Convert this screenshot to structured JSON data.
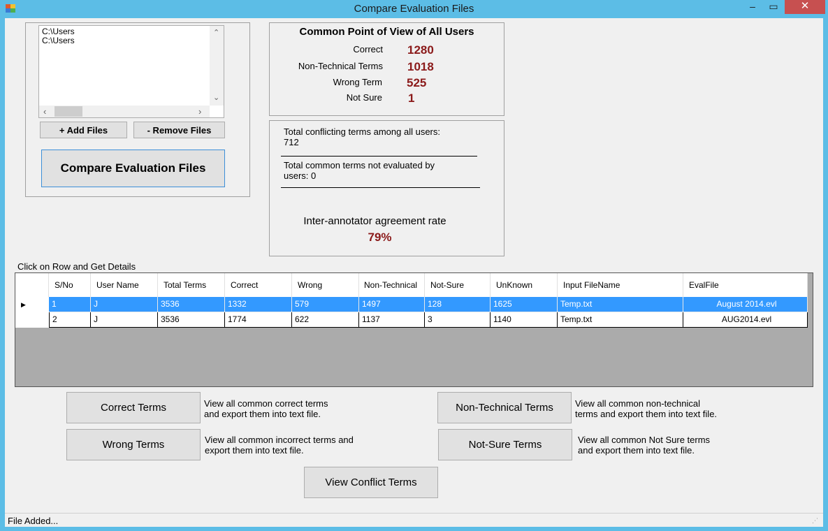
{
  "window": {
    "title": "Compare Evaluation Files",
    "min": "–",
    "max": "▭",
    "close": "✕"
  },
  "files": {
    "items": [
      "C:\\Users",
      "C:\\Users"
    ],
    "add_label": "+ Add Files",
    "remove_label": "- Remove Files",
    "compare_label": "Compare Evaluation Files"
  },
  "common": {
    "title": "Common Point of View of All Users",
    "stats": [
      {
        "label": "Correct",
        "value": "1280"
      },
      {
        "label": "Non-Technical Terms",
        "value": "1018"
      },
      {
        "label": "Wrong Term",
        "value": "525"
      },
      {
        "label": "Not Sure",
        "value": "1"
      }
    ]
  },
  "summary": {
    "conflicting_label": "Total conflicting terms among all users:",
    "conflicting_value": "712",
    "not_evaluated_line1": "Total common terms not evaluated by",
    "not_evaluated_line2": "users: 0",
    "agreement_label": "Inter-annotator agreement rate",
    "agreement_value": "79%"
  },
  "grid": {
    "hint": "Click on Row and Get Details",
    "columns": [
      "S/No",
      "User Name",
      "Total Terms",
      "Correct",
      "Wrong",
      "Non-Technical",
      "Not-Sure",
      "UnKnown",
      "Input FileName",
      "EvalFile"
    ],
    "rows": [
      [
        "1",
        "J",
        "3536",
        "1332",
        "579",
        "1497",
        "128",
        "1625",
        "Temp.txt",
        "August 2014.evl"
      ],
      [
        "2",
        "J",
        "3536",
        "1774",
        "622",
        "1137",
        "3",
        "1140",
        "Temp.txt",
        "AUG2014.evl"
      ]
    ],
    "selected_row": 0
  },
  "actions": {
    "correct_label": "Correct Terms",
    "correct_desc_1": "View all common correct terms",
    "correct_desc_2": "and export them into text file.",
    "wrong_label": "Wrong Terms",
    "wrong_desc_1": "View all common incorrect terms and",
    "wrong_desc_2": "export them into text file.",
    "nontech_label": "Non-Technical Terms",
    "nontech_desc_1": "View all common non-technical",
    "nontech_desc_2": "terms and export them into text file.",
    "notsure_label": "Not-Sure Terms",
    "notsure_desc_1": "View all common Not Sure  terms",
    "notsure_desc_2": "and export them into text file.",
    "conflict_label": "View Conflict Terms"
  },
  "status": {
    "text": "File Added..."
  },
  "colors": {
    "titlebar": "#5cbde6",
    "selection": "#3399ff",
    "value_red": "#8b1a1a",
    "close_button": "#c75050"
  }
}
